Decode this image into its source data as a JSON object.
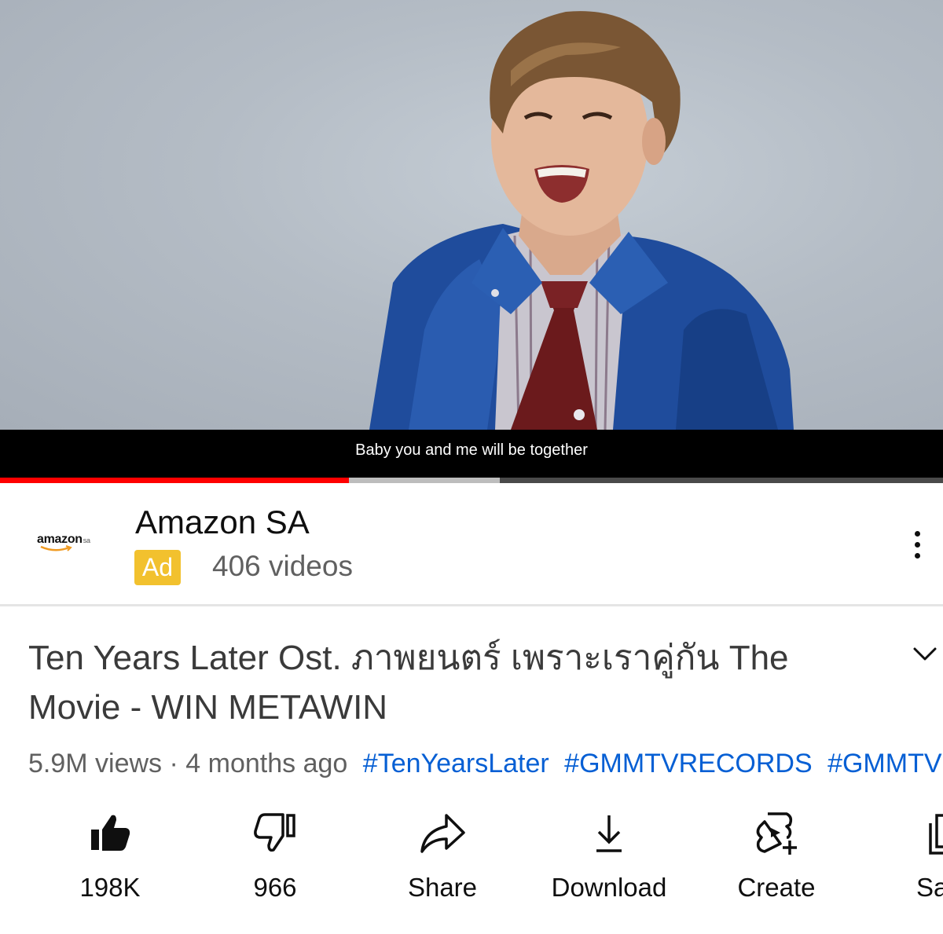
{
  "player": {
    "caption": "Baby you and me will be together",
    "progress_played": 0.37,
    "progress_buffered": 0.53
  },
  "ad": {
    "logo_text": "amazon",
    "logo_sub": "sa",
    "channel_name": "Amazon SA",
    "badge": "Ad",
    "video_count": "406 videos"
  },
  "video": {
    "title": "Ten Years Later Ost. ภาพยนตร์ เพราะเราคู่กัน The Movie - WIN METAWIN",
    "views": "5.9M views",
    "separator": "·",
    "age": "4 months ago",
    "hashtags": [
      "#TenYearsLater",
      "#GMMTVRECORDS",
      "#GMMTV"
    ]
  },
  "actions": [
    {
      "label": "198K",
      "icon": "thumbs-up-filled-icon"
    },
    {
      "label": "966",
      "icon": "thumbs-down-icon"
    },
    {
      "label": "Share",
      "icon": "share-arrow-icon"
    },
    {
      "label": "Download",
      "icon": "download-icon"
    },
    {
      "label": "Create",
      "icon": "create-sparkle-icon"
    },
    {
      "label": "Sa",
      "icon": "save-playlist-icon"
    }
  ],
  "colors": {
    "progress": "#ff0000",
    "ad_badge": "#f2c12e",
    "hashtag": "#065fd4",
    "muted_text": "#606060"
  }
}
